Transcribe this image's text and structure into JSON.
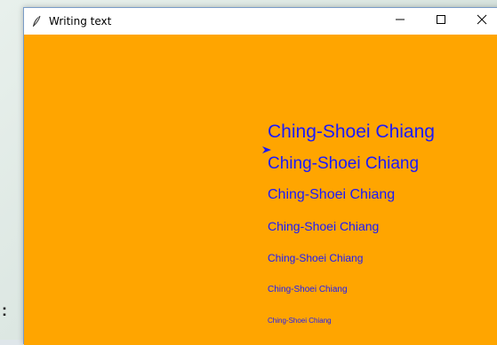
{
  "window": {
    "title": "Writing text",
    "icons": {
      "app": "feather-icon",
      "minimize": "minimize-icon",
      "maximize": "maximize-icon",
      "close": "close-icon"
    }
  },
  "canvas": {
    "background_color": "#ffa500",
    "text_color": "#1a1aff",
    "lines": [
      "Ching-Shoei Chiang",
      "Ching-Shoei Chiang",
      "Ching-Shoei Chiang",
      "Ching-Shoei Chiang",
      "Ching-Shoei Chiang",
      "Ching-Shoei Chiang",
      "Ching-Shoei Chiang"
    ]
  }
}
